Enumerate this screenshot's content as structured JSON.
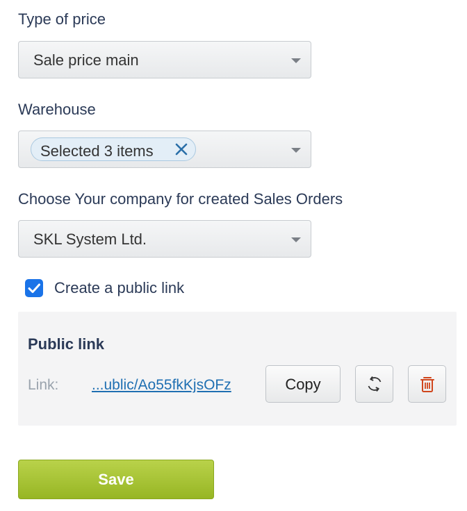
{
  "price_type": {
    "label": "Type of price",
    "value": "Sale price main"
  },
  "warehouse": {
    "label": "Warehouse",
    "chip_text": "Selected 3 items"
  },
  "company": {
    "label": "Choose Your company for created Sales Orders",
    "value": "SKL System Ltd."
  },
  "public_link_checkbox": {
    "label": "Create a public link",
    "checked": true
  },
  "public_link_panel": {
    "title": "Public link",
    "link_key": "Link:",
    "link_value": "...ublic/Ao55fkKjsOFz",
    "copy_label": "Copy",
    "refresh_icon": "refresh-icon",
    "delete_icon": "trash-icon"
  },
  "save_label": "Save",
  "colors": {
    "accent": "#1a73e8",
    "save": "#a7c436",
    "link": "#1f6fb2",
    "delete": "#d0451b"
  }
}
